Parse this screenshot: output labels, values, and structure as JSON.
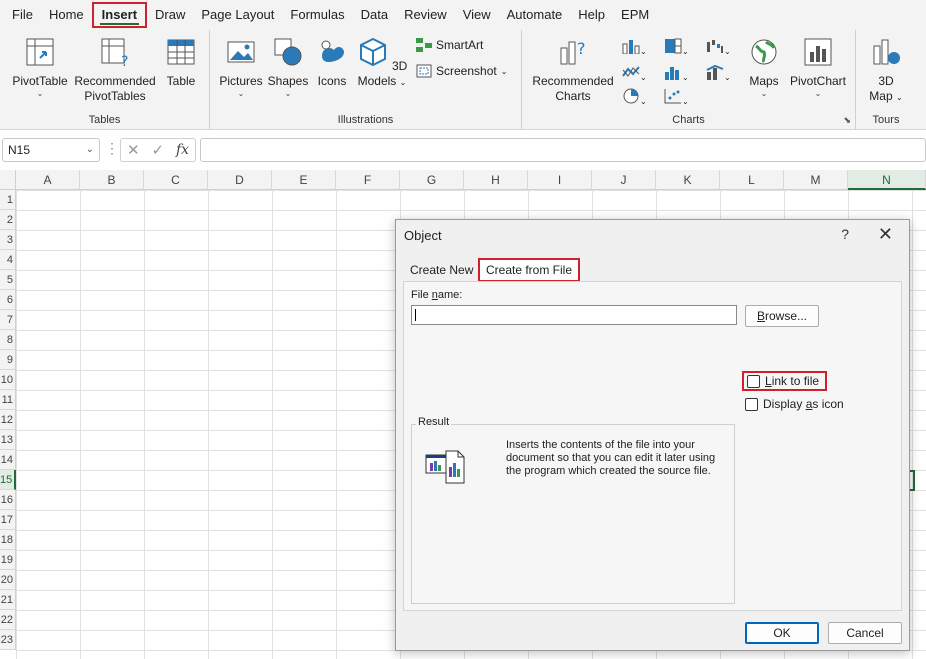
{
  "menu": {
    "items": [
      "File",
      "Home",
      "Insert",
      "Draw",
      "Page Layout",
      "Formulas",
      "Data",
      "Review",
      "View",
      "Automate",
      "Help",
      "EPM"
    ],
    "active": "Insert"
  },
  "ribbon": {
    "tables": {
      "label": "Tables",
      "pivottable": "PivotTable",
      "recommended_pivot_1": "Recommended",
      "recommended_pivot_2": "PivotTables",
      "table": "Table"
    },
    "illustrations": {
      "label": "Illustrations",
      "pictures": "Pictures",
      "shapes": "Shapes",
      "icons": "Icons",
      "models_1": "3D",
      "models_2": "Models",
      "smartart": "SmartArt",
      "screenshot": "Screenshot"
    },
    "charts": {
      "label": "Charts",
      "recommended_1": "Recommended",
      "recommended_2": "Charts",
      "maps": "Maps",
      "pivotchart": "PivotChart"
    },
    "tours": {
      "label": "Tours",
      "map_1": "3D",
      "map_2": "Map"
    }
  },
  "formula_bar": {
    "name_box": "N15",
    "value": ""
  },
  "grid": {
    "columns": [
      "A",
      "B",
      "C",
      "D",
      "E",
      "F",
      "G",
      "H",
      "I",
      "J",
      "K",
      "L",
      "M",
      "N"
    ],
    "rows": [
      "1",
      "2",
      "3",
      "4",
      "5",
      "6",
      "7",
      "8",
      "9",
      "10",
      "11",
      "12",
      "13",
      "14",
      "15",
      "16",
      "17",
      "18",
      "19",
      "20",
      "21",
      "22",
      "23"
    ],
    "selected_column": "N",
    "selected_row": "15"
  },
  "dialog": {
    "title": "Object",
    "help": "?",
    "close": "✕",
    "tabs": [
      "Create New",
      "Create from File"
    ],
    "active_tab": "Create from File",
    "file_name_label_pre": "File ",
    "file_name_label_u": "n",
    "file_name_label_post": "ame:",
    "file_name_value": "",
    "browse_u": "B",
    "browse_rest": "rowse...",
    "link_u": "L",
    "link_rest": "ink to file",
    "display_u": "a",
    "display_pre": "Display ",
    "display_rest": "s icon",
    "result_title": "Result",
    "result_text": "Inserts the contents of the file into your document so that you can edit it later using the program which created the source file.",
    "ok": "OK",
    "cancel": "Cancel"
  }
}
